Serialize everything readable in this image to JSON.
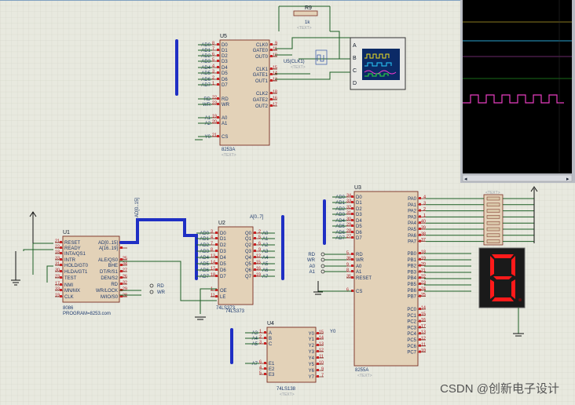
{
  "placeholders": {
    "text": "<TEXT>"
  },
  "watermark": "CSDN @创新电子设计",
  "scope": {
    "scroll_left": "◂",
    "scroll_right": "▸"
  },
  "buses": {
    "ad": "AD[0..15]",
    "a": "A[0..7]",
    "u4_label": "74LS373"
  },
  "r9": {
    "designator": "R9",
    "value": "1k"
  },
  "oscilloscope": {
    "channels": [
      "A",
      "B",
      "C",
      "D"
    ]
  },
  "u5": {
    "designator": "U5",
    "part": "8253A",
    "clk_net": "U5(CLK1)",
    "left_pins": [
      {
        "net": "AD0",
        "num": "8",
        "name": "D0"
      },
      {
        "net": "AD1",
        "num": "7",
        "name": "D1"
      },
      {
        "net": "AD2",
        "num": "6",
        "name": "D2"
      },
      {
        "net": "AD3",
        "num": "5",
        "name": "D3"
      },
      {
        "net": "AD4",
        "num": "4",
        "name": "D4"
      },
      {
        "net": "AD5",
        "num": "3",
        "name": "D5"
      },
      {
        "net": "AD6",
        "num": "2",
        "name": "D6"
      },
      {
        "net": "AD7",
        "num": "1",
        "name": "D7"
      },
      {
        "net": "RD",
        "num": "22",
        "name": "RD"
      },
      {
        "net": "WR",
        "num": "23",
        "name": "WR"
      },
      {
        "net": "A1",
        "num": "19",
        "name": "A0"
      },
      {
        "net": "A2",
        "num": "20",
        "name": "A1"
      },
      {
        "net": "Y0",
        "num": "21",
        "name": "CS"
      }
    ],
    "right_pins": [
      {
        "num": "9",
        "name": "CLK0"
      },
      {
        "num": "11",
        "name": "GATE0"
      },
      {
        "num": "10",
        "name": "OUT0"
      },
      {
        "num": "15",
        "name": "CLK1"
      },
      {
        "num": "14",
        "name": "GATE1"
      },
      {
        "num": "13",
        "name": "OUT1"
      },
      {
        "num": "18",
        "name": "CLK2"
      },
      {
        "num": "16",
        "name": "GATE2"
      },
      {
        "num": "17",
        "name": "OUT2"
      }
    ]
  },
  "u1": {
    "designator": "U1",
    "part": "8086",
    "program": "PROGRAM=8253.com",
    "rd_term": "RD",
    "wr_term": "WR",
    "left_pins": [
      {
        "num": "21",
        "name": "RESET"
      },
      {
        "num": "22",
        "name": "READY"
      },
      {
        "num": "18",
        "name": "INTA/QS1"
      },
      {
        "num": "33",
        "name": "INTR"
      },
      {
        "num": "31",
        "name": "HOLD/GT0"
      },
      {
        "num": "30",
        "name": "HLDA/GT1"
      },
      {
        "num": "23",
        "name": "TEST"
      },
      {
        "num": "17",
        "name": "NMI"
      },
      {
        "num": "33",
        "name": "MN/MX"
      },
      {
        "num": "19",
        "name": "CLK"
      }
    ],
    "right_pins": [
      {
        "num": "",
        "name": "AD[0..15]"
      },
      {
        "num": "",
        "name": "A[16..19]"
      },
      {
        "num": "25",
        "name": "ALE/QS0"
      },
      {
        "num": "34",
        "name": "BHE"
      },
      {
        "num": "27",
        "name": "DT/R/S1"
      },
      {
        "num": "26",
        "name": "DEN/S2"
      },
      {
        "num": "32",
        "name": "RD"
      },
      {
        "num": "29",
        "name": "WR/LOCK"
      },
      {
        "num": "28",
        "name": "M/IO/S0"
      }
    ]
  },
  "u2": {
    "designator": "U2",
    "part": "74LS373",
    "left_pins": [
      {
        "net": "AD0",
        "num": "3",
        "name": "D0"
      },
      {
        "net": "AD1",
        "num": "4",
        "name": "D1"
      },
      {
        "net": "AD2",
        "num": "7",
        "name": "D2"
      },
      {
        "net": "AD3",
        "num": "8",
        "name": "D3"
      },
      {
        "net": "AD4",
        "num": "13",
        "name": "D4"
      },
      {
        "net": "AD5",
        "num": "14",
        "name": "D5"
      },
      {
        "net": "AD6",
        "num": "17",
        "name": "D6"
      },
      {
        "net": "AD7",
        "num": "18",
        "name": "D7"
      },
      {
        "net": "",
        "num": "1",
        "name": "OE"
      },
      {
        "net": "",
        "num": "11",
        "name": "LE"
      }
    ],
    "right_pins": [
      {
        "net": "A0",
        "num": "2",
        "name": "Q0"
      },
      {
        "net": "A1",
        "num": "5",
        "name": "Q1"
      },
      {
        "net": "A2",
        "num": "6",
        "name": "Q2"
      },
      {
        "net": "A3",
        "num": "9",
        "name": "Q3"
      },
      {
        "net": "A4",
        "num": "12",
        "name": "Q4"
      },
      {
        "net": "A5",
        "num": "15",
        "name": "Q5"
      },
      {
        "net": "A6",
        "num": "16",
        "name": "Q6"
      },
      {
        "net": "A7",
        "num": "19",
        "name": "Q7"
      }
    ]
  },
  "u4": {
    "designator": "U4",
    "part": "74LS138",
    "y0_net": "Y0",
    "left_pins": [
      {
        "net": "A3",
        "num": "1",
        "name": "A"
      },
      {
        "net": "A4",
        "num": "2",
        "name": "B"
      },
      {
        "net": "A5",
        "num": "3",
        "name": "C"
      },
      {
        "net": "A7",
        "num": "6",
        "name": "E1"
      },
      {
        "net": "",
        "num": "4",
        "name": "E2"
      },
      {
        "net": "",
        "num": "5",
        "name": "E3"
      }
    ],
    "right_pins": [
      {
        "num": "15",
        "name": "Y0"
      },
      {
        "num": "14",
        "name": "Y1"
      },
      {
        "num": "13",
        "name": "Y2"
      },
      {
        "num": "12",
        "name": "Y3"
      },
      {
        "num": "11",
        "name": "Y4"
      },
      {
        "num": "10",
        "name": "Y5"
      },
      {
        "num": "9",
        "name": "Y6"
      },
      {
        "num": "7",
        "name": "Y7"
      }
    ]
  },
  "u3": {
    "designator": "U3",
    "part": "8255A",
    "left_pins": [
      {
        "net": "AD0",
        "num": "34",
        "name": "D0"
      },
      {
        "net": "AD1",
        "num": "33",
        "name": "D1"
      },
      {
        "net": "AD2",
        "num": "32",
        "name": "D2"
      },
      {
        "net": "AD3",
        "num": "31",
        "name": "D3"
      },
      {
        "net": "AD4",
        "num": "30",
        "name": "D4"
      },
      {
        "net": "AD5",
        "num": "29",
        "name": "D5"
      },
      {
        "net": "AD6",
        "num": "28",
        "name": "D6"
      },
      {
        "net": "AD7",
        "num": "27",
        "name": "D7"
      },
      {
        "net": "",
        "num": "5",
        "name": "RD"
      },
      {
        "net": "",
        "num": "36",
        "name": "WR"
      },
      {
        "net": "",
        "num": "9",
        "name": "A0"
      },
      {
        "net": "",
        "num": "8",
        "name": "A1"
      },
      {
        "net": "",
        "num": "35",
        "name": "RESET"
      },
      {
        "net": "",
        "num": "6",
        "name": "CS"
      }
    ],
    "right_pins": [
      {
        "num": "4",
        "name": "PA0"
      },
      {
        "num": "3",
        "name": "PA1"
      },
      {
        "num": "2",
        "name": "PA2"
      },
      {
        "num": "1",
        "name": "PA3"
      },
      {
        "num": "40",
        "name": "PA4"
      },
      {
        "num": "39",
        "name": "PA5"
      },
      {
        "num": "38",
        "name": "PA6"
      },
      {
        "num": "37",
        "name": "PA7"
      },
      {
        "num": "18",
        "name": "PB0"
      },
      {
        "num": "19",
        "name": "PB1"
      },
      {
        "num": "20",
        "name": "PB2"
      },
      {
        "num": "21",
        "name": "PB3"
      },
      {
        "num": "22",
        "name": "PB4"
      },
      {
        "num": "23",
        "name": "PB5"
      },
      {
        "num": "24",
        "name": "PB6"
      },
      {
        "num": "25",
        "name": "PB7"
      },
      {
        "num": "14",
        "name": "PC0"
      },
      {
        "num": "15",
        "name": "PC1"
      },
      {
        "num": "16",
        "name": "PC2"
      },
      {
        "num": "17",
        "name": "PC3"
      },
      {
        "num": "13",
        "name": "PC4"
      },
      {
        "num": "12",
        "name": "PC5"
      },
      {
        "num": "11",
        "name": "PC6"
      },
      {
        "num": "10",
        "name": "PC7"
      }
    ],
    "terminals": [
      "RD",
      "WR",
      "A0",
      "A1"
    ]
  }
}
